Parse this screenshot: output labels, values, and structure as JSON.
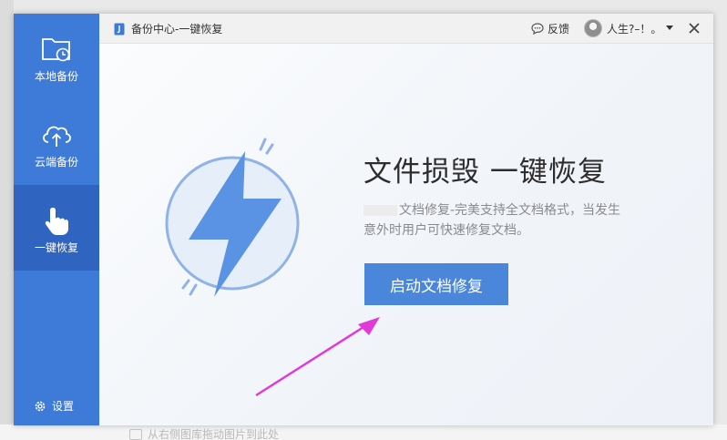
{
  "sidebar": {
    "items": [
      {
        "label": "本地备份",
        "icon": "folder-clock-icon"
      },
      {
        "label": "云端备份",
        "icon": "cloud-upload-icon"
      },
      {
        "label": "一键恢复",
        "icon": "hand-pointer-icon"
      }
    ],
    "settings_label": "设置"
  },
  "titlebar": {
    "title": "备份中心-一键恢复",
    "feedback_label": "反馈",
    "username": "人生?–！。"
  },
  "main": {
    "headline": "文件损毁  一键恢复",
    "desc_line1": "文档修复-完美支持全文档格式，当发生",
    "desc_line2": "意外时用户可快速修复文档。",
    "button_label": "启动文档修复"
  },
  "background": {
    "hint": "从右侧图库拖动图片到此处"
  },
  "colors": {
    "sidebar": "#3e7bd8",
    "sidebar_active": "#2f64c0",
    "button": "#4a86d9",
    "arrow": "#e03ad8"
  }
}
